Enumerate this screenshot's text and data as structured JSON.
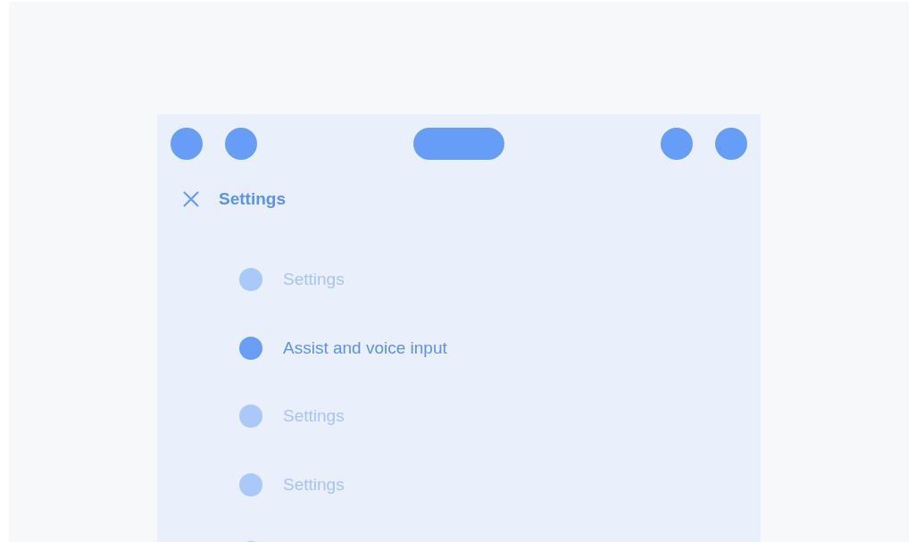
{
  "header": {
    "title": "Settings"
  },
  "items": [
    {
      "label": "Settings",
      "selected": false
    },
    {
      "label": "Assist and voice input",
      "selected": true
    },
    {
      "label": "Settings",
      "selected": false
    },
    {
      "label": "Settings",
      "selected": false
    },
    {
      "selected": false
    }
  ]
}
